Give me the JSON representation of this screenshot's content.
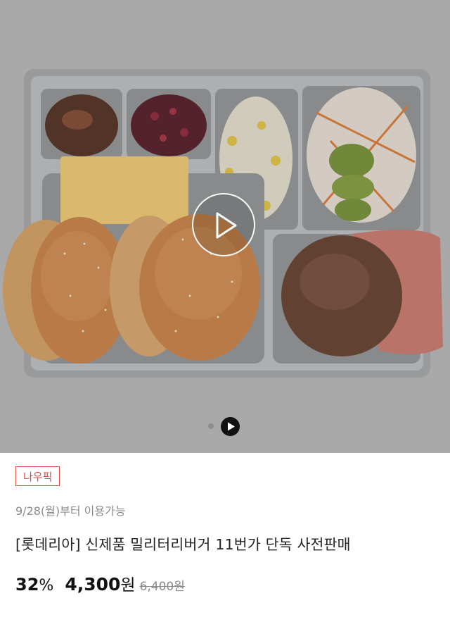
{
  "media": {
    "image_description": "lunch-tray-with-burger-buns-cheese-patty-salad",
    "play_icon": "play-icon",
    "pager": {
      "total": 2,
      "active_index": 1
    }
  },
  "product": {
    "badge": "나우픽",
    "availability": "9/28(월)부터 이용가능",
    "title": "[롯데리아] 신제품 밀리터리버거 11번가 단독 사전판매",
    "discount_number": "32",
    "discount_unit": "%",
    "price_number": "4,300",
    "price_unit": "원",
    "original_price": "6,400원"
  },
  "colors": {
    "hero_background": "#b4b4b4",
    "badge_red": "#e0483f",
    "muted_text": "#8a8a8a",
    "text": "#222222"
  }
}
